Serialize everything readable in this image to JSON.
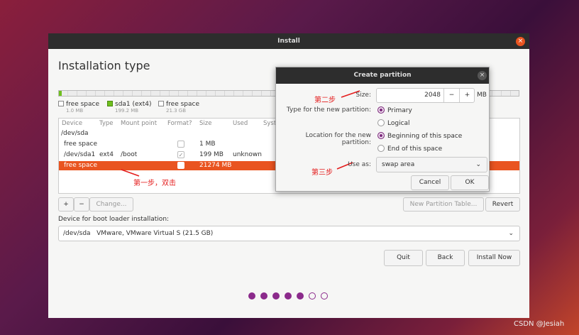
{
  "window": {
    "title": "Install",
    "page_title": "Installation type"
  },
  "legend": [
    {
      "label": "free space",
      "size": "1.0 MB",
      "color": "#ffffff"
    },
    {
      "label": "sda1 (ext4)",
      "size": "199.2 MB",
      "color": "#6fbf1e"
    },
    {
      "label": "free space",
      "size": "21.3 GB",
      "color": "#ffffff"
    }
  ],
  "table": {
    "headers": [
      "Device",
      "Type",
      "Mount point",
      "Format?",
      "Size",
      "Used",
      "Syst"
    ],
    "group": "/dev/sda",
    "rows": [
      {
        "device": "free space",
        "type": "",
        "mount": "",
        "format": false,
        "size": "1 MB",
        "used": ""
      },
      {
        "device": "/dev/sda1",
        "type": "ext4",
        "mount": "/boot",
        "format": true,
        "size": "199 MB",
        "used": "unknown"
      },
      {
        "device": "free space",
        "type": "",
        "mount": "",
        "format": false,
        "size": "21274 MB",
        "used": "",
        "selected": true
      }
    ]
  },
  "toolbar": {
    "add": "+",
    "remove": "−",
    "change": "Change...",
    "new_table": "New Partition Table...",
    "revert": "Revert"
  },
  "bootloader": {
    "label": "Device for boot loader installation:",
    "value": "/dev/sda   VMware, VMware Virtual S (21.5 GB)"
  },
  "buttons": {
    "quit": "Quit",
    "back": "Back",
    "install": "Install Now"
  },
  "progress": {
    "total": 7,
    "current": 5
  },
  "dialog": {
    "title": "Create partition",
    "size_label": "Size:",
    "size_value": "2048",
    "size_unit": "MB",
    "type_label": "Type for the new partition:",
    "primary": "Primary",
    "logical": "Logical",
    "location_label": "Location for the new partition:",
    "beginning": "Beginning of this space",
    "end": "End of this space",
    "use_label": "Use as:",
    "use_value": "swap area",
    "cancel": "Cancel",
    "ok": "OK"
  },
  "annotations": {
    "step1": "第一步，双击",
    "step2": "第二步",
    "step3": "第三步"
  },
  "watermark": "CSDN @Jesiah"
}
